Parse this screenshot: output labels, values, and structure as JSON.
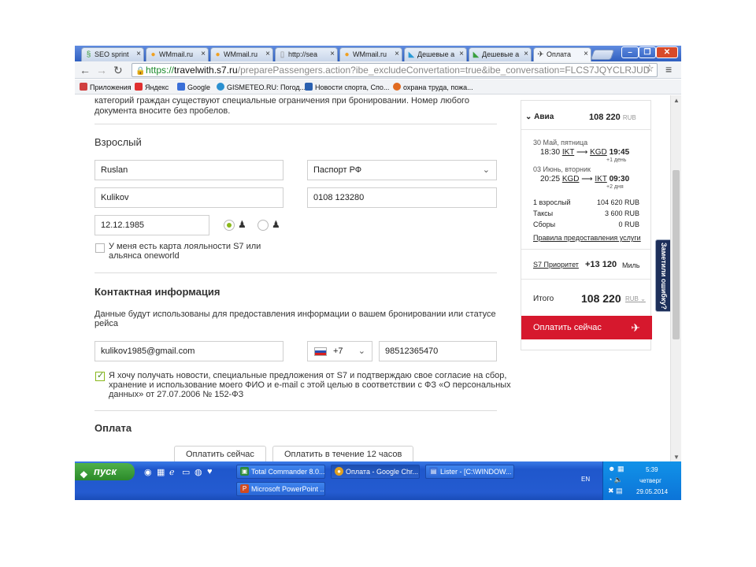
{
  "browser": {
    "tabs": [
      {
        "label": "SEO sprint",
        "icon": "seo-sprint-favicon",
        "color": "#3a9a3a"
      },
      {
        "label": "WMmail.ru",
        "icon": "wmmail-favicon",
        "color": "#f0a020"
      },
      {
        "label": "WMmail.ru",
        "icon": "wmmail-favicon",
        "color": "#f0a020"
      },
      {
        "label": "http://sea",
        "icon": "page-icon",
        "color": "#888888"
      },
      {
        "label": "WMmail.ru",
        "icon": "wmmail-favicon",
        "color": "#f0a020"
      },
      {
        "label": "Дешевые а",
        "icon": "aviasales-favicon",
        "color": "#2a9ad6"
      },
      {
        "label": "Дешевые а",
        "icon": "aviasales-favicon",
        "color": "#3aa040"
      },
      {
        "label": "Оплата",
        "icon": "plane-icon",
        "color": "#444444"
      }
    ],
    "close_glyph": "×",
    "url_https": "https://",
    "url_host": "travelwith.s7.ru",
    "url_rest": "/preparePassengers.action?ibe_excludeConvertation=true&ibe_conversation=FLCS7JQYCLRJUD",
    "win_buttons": [
      "–",
      "❐",
      "✕"
    ],
    "bookmarks": [
      {
        "label": "Приложения",
        "color": "#d04040"
      },
      {
        "label": "Яндекс",
        "color": "#e03030"
      },
      {
        "label": "Google",
        "color": "#3a6fd8"
      },
      {
        "label": "GISMETEO.RU: Погод...",
        "color": "#2a90d0"
      },
      {
        "label": "Новости спорта, Спо...",
        "color": "#2a60b0"
      },
      {
        "label": "охрана труда, пожа...",
        "color": "#e06a20"
      }
    ]
  },
  "form": {
    "intro_line1": "категорий граждан существуют специальные ограничения при бронировании. Номер любого",
    "intro_line2": "документа вносите без пробелов.",
    "adult_title": "Взрослый",
    "first_name": "Ruslan",
    "last_name": "Kulikov",
    "doc_type": "Паспорт РФ",
    "doc_number": "0108 123280",
    "birth_date": "12.12.1985",
    "loyalty_line1": "У меня есть карта лояльности S7 или",
    "loyalty_line2": "альянса oneworld",
    "contact_title": "Контактная информация",
    "contact_note_line1": "Данные будут использованы для предоставления информации о вашем бронировании или статусе",
    "contact_note_line2": "рейса",
    "email": "kulikov1985@gmail.com",
    "phone_code": "+7",
    "phone_number": "98512365470",
    "consent_line1": "Я хочу получать новости, специальные предложения от S7 и подтверждаю свое согласие на сбор,",
    "consent_line2": "хранение и использование моего ФИО и e-mail с этой целью в соответствии с ФЗ «О персональных",
    "consent_line3": "данных» от 27.07.2006 № 152-ФЗ",
    "payment_title": "Оплата",
    "pay_now_tab": "Оплатить сейчас",
    "pay_later_tab": "Оплатить в течение 12 часов"
  },
  "summary": {
    "section": "Авиа",
    "total_top": "108 220",
    "currency": "RUB",
    "out_date": "30 Май, пятница",
    "out_dep_time": "18:30",
    "out_from": "IKT",
    "out_to": "KGD",
    "out_arr_time": "19:45",
    "out_plus": "+1 день",
    "ret_date": "03 Июнь, вторник",
    "ret_dep_time": "20:25",
    "ret_from": "KGD",
    "ret_to": "IKT",
    "ret_arr_time": "09:30",
    "ret_plus": "+2 дня",
    "rows": [
      {
        "label": "1 взрослый",
        "value": "104 620 RUB"
      },
      {
        "label": "Таксы",
        "value": "3 600 RUB"
      },
      {
        "label": "Сборы",
        "value": "0 RUB"
      }
    ],
    "rules_link": "Правила предоставления услуги",
    "priority_link": "S7 Приоритет",
    "miles_value": "+13 120",
    "miles_unit": "Миль",
    "total_label": "Итого",
    "total_value": "108 220",
    "pay_button": "Оплатить сейчас",
    "feedback_tab": "Заметили ошибку?"
  },
  "taskbar": {
    "start": "пуск",
    "tasks": [
      {
        "label": "Total Commander 8.0...",
        "color": "#2a8a3a"
      },
      {
        "label": "Оплата - Google Chr...",
        "color": "#e0a020"
      },
      {
        "label": "Lister - [C:\\WINDOW...",
        "color": "#3a6fd8"
      },
      {
        "label": "Microsoft PowerPoint ...",
        "color": "#d04a20"
      }
    ],
    "lang": "EN",
    "time": "5:39",
    "day": "четверг",
    "date": "29.05.2014"
  },
  "colors": {
    "accent_red": "#d6182d",
    "radio_green": "#8ab81b",
    "xp_blue": "#245bd0"
  }
}
